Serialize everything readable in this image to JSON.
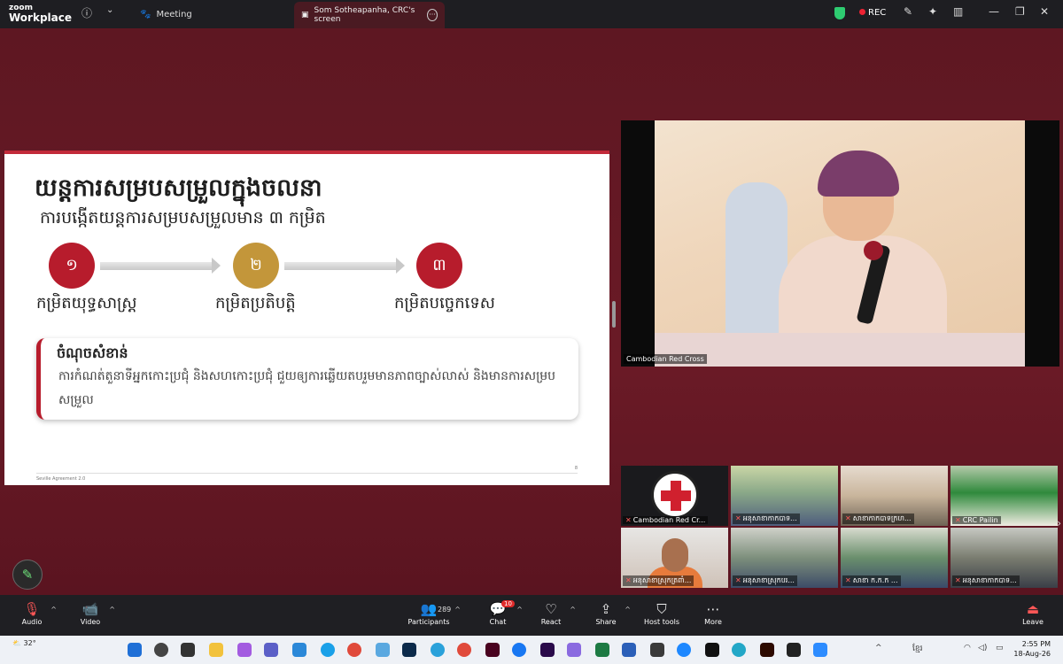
{
  "titlebar": {
    "logo_line1": "zoom",
    "logo_line2": "Workplace",
    "meeting_tab": "Meeting",
    "screen_tab": "Som Sotheapanha, CRC's screen",
    "rec_label": "REC"
  },
  "slide": {
    "title": "យន្តការសម្របសម្រួលក្នុងចលនា",
    "subtitle": "ការបង្កើតយន្តការសម្របសម្រួលមាន ៣ កម្រិត",
    "steps": [
      {
        "number": "១",
        "label": "កម្រិតយុទ្ធសាស្ត្រ"
      },
      {
        "number": "២",
        "label": "កម្រិតប្រតិបត្តិ"
      },
      {
        "number": "៣",
        "label": "កម្រិតបច្ចេកទេស"
      }
    ],
    "note_title": "ចំណុចសំខាន់",
    "note_body": "ការកំណត់តួនាទីអ្នកកោះប្រជុំ និងសហកោះប្រជុំ ជួយឲ្យការឆ្លើយតបរួមមានភាពច្បាស់លាស់ និងមានការសម្របសម្រួល",
    "footer": "Seville Agreement 2.0",
    "page_number": "8",
    "accent_red": "#b71c2c",
    "accent_gold": "#c3963a"
  },
  "speaker": {
    "name": "Cambodian Red Cross"
  },
  "thumbnails": [
    {
      "label": "Cambodian Red Cr..."
    },
    {
      "label": "អនុសាខាកាកបាទ..."
    },
    {
      "label": "សាខាកាកបាទក្រហ..."
    },
    {
      "label": "CRC Pailin"
    },
    {
      "label": "អនុសាខាស្រុកត្រពាំ..."
    },
    {
      "label": "អនុសាខាស្រុកបរ..."
    },
    {
      "label": "សាខា ក.ក.ក ..."
    },
    {
      "label": "អនុសាខាកាកបាទ..."
    }
  ],
  "toolbar": {
    "audio": "Audio",
    "video": "Video",
    "participants": "Participants",
    "participants_count": "289",
    "chat": "Chat",
    "chat_badge": "10",
    "react": "React",
    "share": "Share",
    "host_tools": "Host tools",
    "more": "More",
    "leave": "Leave"
  },
  "taskbar": {
    "temperature": "32°",
    "time": "2:55 PM",
    "date": "18-Aug-26",
    "language": "ខ្មែរ"
  }
}
